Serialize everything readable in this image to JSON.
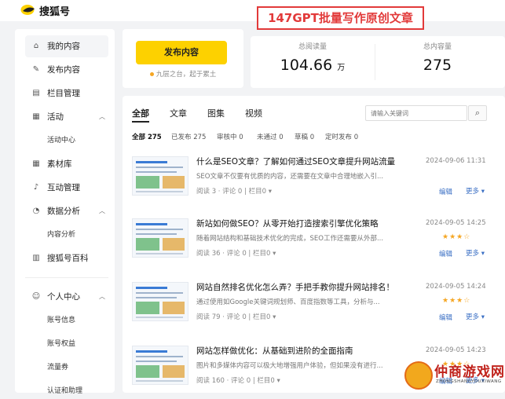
{
  "header": {
    "logo_text": "搜狐号"
  },
  "banner": {
    "text": "147GPT批量写作原创文章"
  },
  "sidebar": {
    "items": [
      {
        "label": "我的内容",
        "icon": "home-icon"
      },
      {
        "label": "发布内容",
        "icon": "pencil-icon"
      },
      {
        "label": "栏目管理",
        "icon": "document-icon"
      },
      {
        "label": "活动",
        "icon": "calendar-icon"
      },
      {
        "label": "活动中心"
      },
      {
        "label": "素材库",
        "icon": "grid-icon"
      },
      {
        "label": "互动管理",
        "icon": "bell-icon"
      },
      {
        "label": "数据分析",
        "icon": "pie-chart-icon"
      },
      {
        "label": "内容分析"
      },
      {
        "label": "搜狐号百科",
        "icon": "book-icon"
      },
      {
        "label": "个人中心",
        "icon": "user-icon"
      },
      {
        "label": "账号信息"
      },
      {
        "label": "账号权益"
      },
      {
        "label": "流量券"
      },
      {
        "label": "认证和助理"
      }
    ]
  },
  "publish": {
    "button_label": "发布内容",
    "note": "九层之台，起于累土"
  },
  "stats": {
    "total_reads_label": "总阅读量",
    "total_reads_value": "104.66",
    "total_reads_unit": "万",
    "total_content_label": "总内容量",
    "total_content_value": "275"
  },
  "tabs": [
    "全部",
    "文章",
    "图集",
    "视频"
  ],
  "search": {
    "placeholder": "请输入关键词",
    "icon": "search-icon"
  },
  "filters": [
    "全部 275",
    "已发布 275",
    "审核中 0",
    "未通过 0",
    "草稿 0",
    "定时发布 0"
  ],
  "articles": [
    {
      "title": "什么是SEO文章？了解如何通过SEO文章提升网站流量",
      "date": "2024-09-06 11:31",
      "desc": "SEO文章不仅要有优质的内容，还需要在文章中合理地嵌入引...",
      "stars": "",
      "meta": "阅读 3 · 评论 0 | 栏目0 ▾",
      "edit": "编辑",
      "more": "更多 ▾"
    },
    {
      "title": "新站如何做SEO？从零开始打造搜索引擎优化策略",
      "date": "2024-09-05 14:25",
      "desc": "随着网站结构和基础技术优化的完成，SEO工作还需要从外部...",
      "stars": "★★★☆",
      "meta": "阅读 36 · 评论 0 | 栏目0 ▾",
      "edit": "编辑",
      "more": "更多 ▾"
    },
    {
      "title": "网站自然排名优化怎么弄？手把手教你提升网站排名！",
      "date": "2024-09-05 14:24",
      "desc": "通过使用如Google关键词规划师、百度指数等工具，分析与...",
      "stars": "★★★☆",
      "meta": "阅读 79 · 评论 0 | 栏目0 ▾",
      "edit": "编辑",
      "more": "更多 ▾"
    },
    {
      "title": "网站怎样做优化：从基础到进阶的全面指南",
      "date": "2024-09-05 14:23",
      "desc": "图片和多媒体内容可以极大地增强用户体验，但如果没有进行...",
      "stars": "★★★☆",
      "meta": "阅读 160 · 评论 0 | 栏目0 ▾",
      "edit": "编辑",
      "more": "更多 ▾"
    }
  ],
  "watermark": {
    "text": "仲商游戏网",
    "sub": "ZHONGSHANGYOUXIWANG"
  }
}
